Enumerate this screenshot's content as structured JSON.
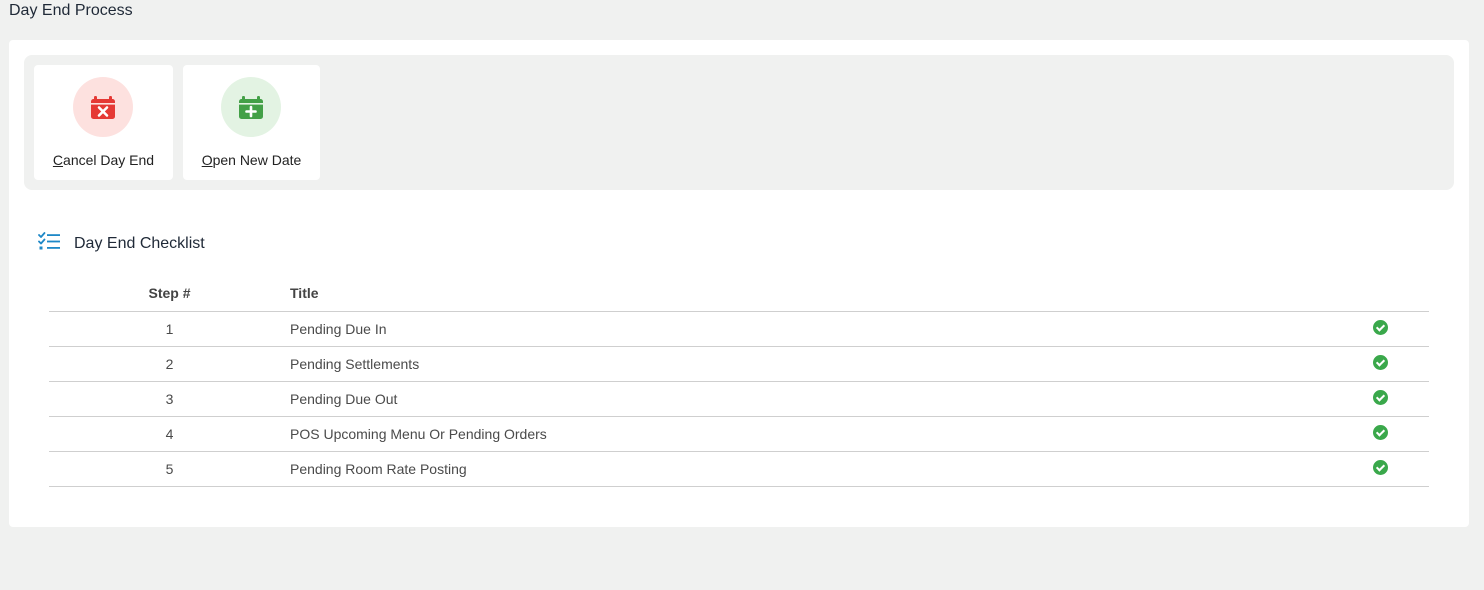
{
  "page": {
    "title": "Day End Process"
  },
  "actions": [
    {
      "accesskey": "C",
      "rest": "ancel Day End",
      "icon": "calendar-cancel-icon",
      "color": "#e53935"
    },
    {
      "accesskey": "O",
      "rest": "pen New Date",
      "icon": "calendar-plus-icon",
      "color": "#43a047"
    }
  ],
  "checklist": {
    "title": "Day End Checklist",
    "icon": "checklist-icon",
    "headers": {
      "step": "Step #",
      "title": "Title"
    },
    "rows": [
      {
        "step": "1",
        "title": "Pending Due In",
        "status": "complete"
      },
      {
        "step": "2",
        "title": "Pending Settlements",
        "status": "complete"
      },
      {
        "step": "3",
        "title": "Pending Due Out",
        "status": "complete"
      },
      {
        "step": "4",
        "title": "POS Upcoming Menu Or Pending Orders",
        "status": "complete"
      },
      {
        "step": "5",
        "title": "Pending Room Rate Posting",
        "status": "complete"
      }
    ]
  },
  "colors": {
    "success": "#3aa84b",
    "accent": "#1e88c7"
  }
}
